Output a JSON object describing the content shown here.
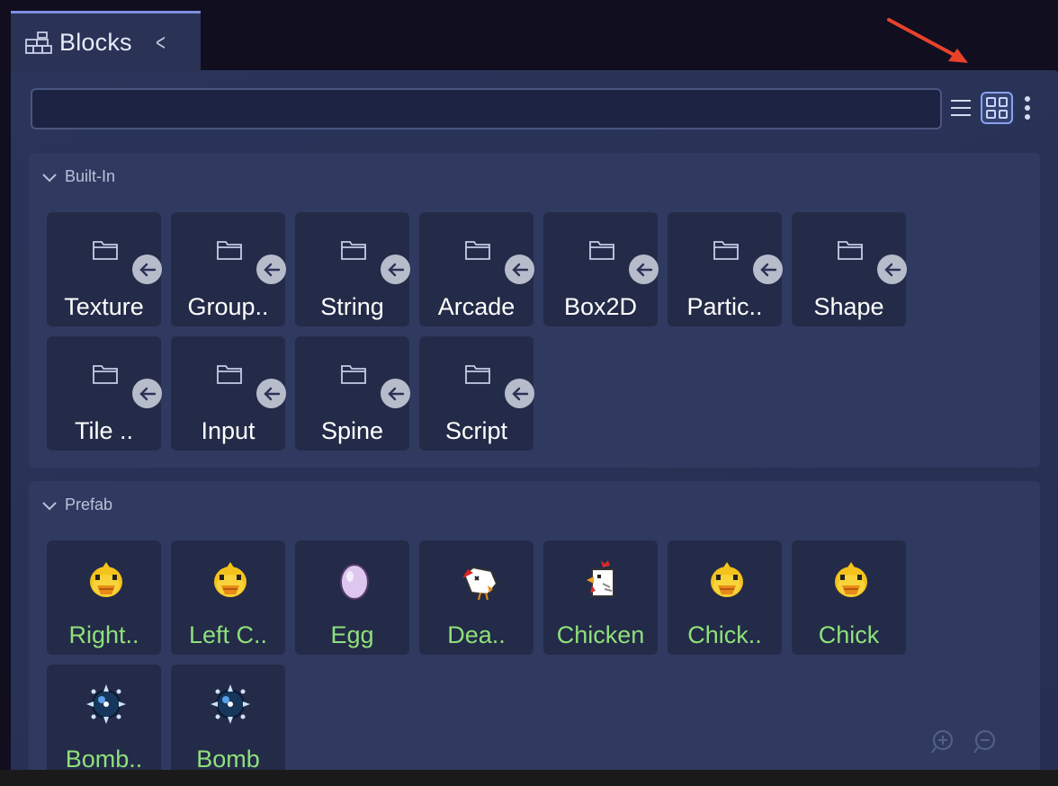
{
  "tab": {
    "title": "Blocks",
    "collapse_glyph": "<"
  },
  "search": {
    "value": "",
    "placeholder": ""
  },
  "toolbar": {
    "list_view_icon": "list-icon",
    "grid_view_icon": "grid-icon",
    "more_icon": "kebab-icon",
    "grid_view_active": true
  },
  "sections": {
    "builtin": {
      "title": "Built-In",
      "items": [
        {
          "label": "Texture"
        },
        {
          "label": "Group.."
        },
        {
          "label": "String"
        },
        {
          "label": "Arcade"
        },
        {
          "label": "Box2D"
        },
        {
          "label": "Partic.."
        },
        {
          "label": "Shape"
        },
        {
          "label": "Tile .."
        },
        {
          "label": "Input"
        },
        {
          "label": "Spine"
        },
        {
          "label": "Script"
        }
      ]
    },
    "prefab": {
      "title": "Prefab",
      "items": [
        {
          "label": "Right..",
          "icon": "chick-icon"
        },
        {
          "label": "Left C..",
          "icon": "chick-icon"
        },
        {
          "label": "Egg",
          "icon": "egg-icon"
        },
        {
          "label": "Dea..",
          "icon": "dead-chicken-icon"
        },
        {
          "label": "Chicken",
          "icon": "chicken-icon"
        },
        {
          "label": "Chick..",
          "icon": "chick-icon"
        },
        {
          "label": "Chick",
          "icon": "chick-icon"
        },
        {
          "label": "Bomb..",
          "icon": "bomb-icon"
        },
        {
          "label": "Bomb",
          "icon": "bomb-icon"
        }
      ]
    }
  },
  "zoom": {
    "zoom_in_icon": "zoom-in-icon",
    "zoom_out_icon": "zoom-out-icon"
  },
  "colors": {
    "panel": "#2a3356",
    "card": "#232b48",
    "accent": "#8aa0f0",
    "prefab_label": "#8fe07a",
    "annotation_arrow": "#e8432a"
  }
}
